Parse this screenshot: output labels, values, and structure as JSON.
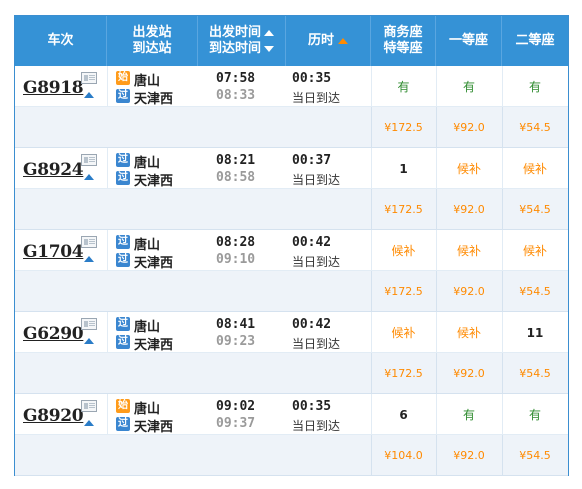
{
  "header": {
    "train_no": "车次",
    "station_from": "出发站",
    "station_to": "到达站",
    "time_depart": "出发时间",
    "time_arrive": "到达时间",
    "duration": "历时",
    "biz_line1": "商务座",
    "biz_line2": "特等座",
    "first": "一等座",
    "second": "二等座"
  },
  "trains": [
    {
      "code": "G8918",
      "from_badge": "始",
      "from_badge_type": "start",
      "from": "唐山",
      "to_badge": "过",
      "to": "天津西",
      "depart": "07:58",
      "arrive": "08:33",
      "duration": "00:35",
      "arrive_day": "当日到达",
      "biz": "有",
      "biz_type": "avail",
      "first": "有",
      "first_type": "avail",
      "second": "有",
      "second_type": "avail",
      "biz_price": "¥172.5",
      "first_price": "¥92.0",
      "second_price": "¥54.5"
    },
    {
      "code": "G8924",
      "from_badge": "过",
      "from_badge_type": "pass",
      "from": "唐山",
      "to_badge": "过",
      "to": "天津西",
      "depart": "08:21",
      "arrive": "08:58",
      "duration": "00:37",
      "arrive_day": "当日到达",
      "biz": "1",
      "biz_type": "num",
      "first": "候补",
      "first_type": "wait",
      "second": "候补",
      "second_type": "wait",
      "biz_price": "¥172.5",
      "first_price": "¥92.0",
      "second_price": "¥54.5"
    },
    {
      "code": "G1704",
      "from_badge": "过",
      "from_badge_type": "pass",
      "from": "唐山",
      "to_badge": "过",
      "to": "天津西",
      "depart": "08:28",
      "arrive": "09:10",
      "duration": "00:42",
      "arrive_day": "当日到达",
      "biz": "候补",
      "biz_type": "wait",
      "first": "候补",
      "first_type": "wait",
      "second": "候补",
      "second_type": "wait",
      "biz_price": "¥172.5",
      "first_price": "¥92.0",
      "second_price": "¥54.5"
    },
    {
      "code": "G6290",
      "from_badge": "过",
      "from_badge_type": "pass",
      "from": "唐山",
      "to_badge": "过",
      "to": "天津西",
      "depart": "08:41",
      "arrive": "09:23",
      "duration": "00:42",
      "arrive_day": "当日到达",
      "biz": "候补",
      "biz_type": "wait",
      "first": "候补",
      "first_type": "wait",
      "second": "11",
      "second_type": "num",
      "biz_price": "¥172.5",
      "first_price": "¥92.0",
      "second_price": "¥54.5"
    },
    {
      "code": "G8920",
      "from_badge": "始",
      "from_badge_type": "start",
      "from": "唐山",
      "to_badge": "过",
      "to": "天津西",
      "depart": "09:02",
      "arrive": "09:37",
      "duration": "00:35",
      "arrive_day": "当日到达",
      "biz": "6",
      "biz_type": "num",
      "first": "有",
      "first_type": "avail",
      "second": "有",
      "second_type": "avail",
      "biz_price": "¥104.0",
      "first_price": "¥92.0",
      "second_price": "¥54.5"
    }
  ]
}
